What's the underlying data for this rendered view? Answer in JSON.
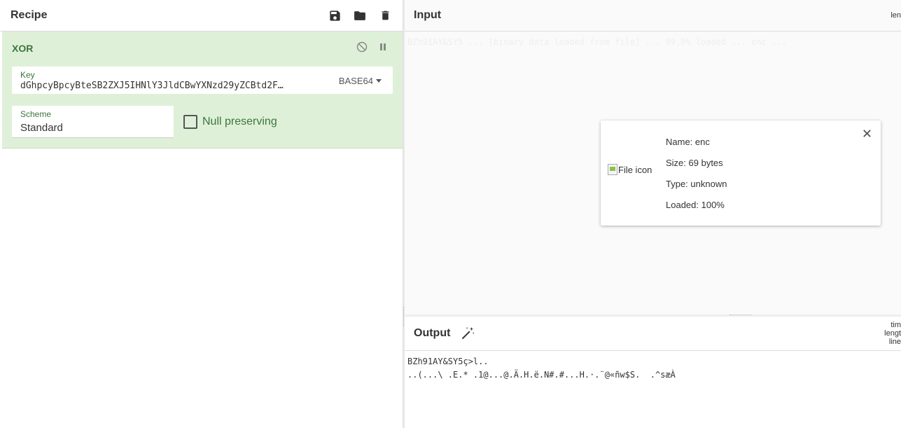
{
  "recipe": {
    "title": "Recipe",
    "icons": [
      "save-icon",
      "folder-icon",
      "trash-icon"
    ],
    "operation": {
      "name": "XOR",
      "key_label": "Key",
      "key_value": "dGhpcyBpcyBteSB2ZXJ5IHNlY3JldCBwYXNzd29yZCBtd2F…",
      "key_encoding": "BASE64",
      "scheme_label": "Scheme",
      "scheme_value": "Standard",
      "null_preserving_label": "Null preserving",
      "null_preserving_checked": false
    }
  },
  "input": {
    "title": "Input",
    "stats": "len",
    "file": {
      "icon_alt": "File icon",
      "name": "Name: enc",
      "size": "Size: 69 bytes",
      "type": "Type: unknown",
      "loaded": "Loaded: 100%"
    }
  },
  "output": {
    "title": "Output",
    "stats": [
      "tim",
      "lengt",
      "line"
    ],
    "lines": [
      "BZh91AY&SY5ç>l..",
      "..(...\\ .E.* .1@...@.Ä.H.ë.N#.#...H.·.¨@«ñw$S.  .^sæÀ"
    ]
  },
  "colors": {
    "op_bg": "#dff0d8",
    "op_text": "#3c763d",
    "pane_bg": "#fafafa"
  }
}
